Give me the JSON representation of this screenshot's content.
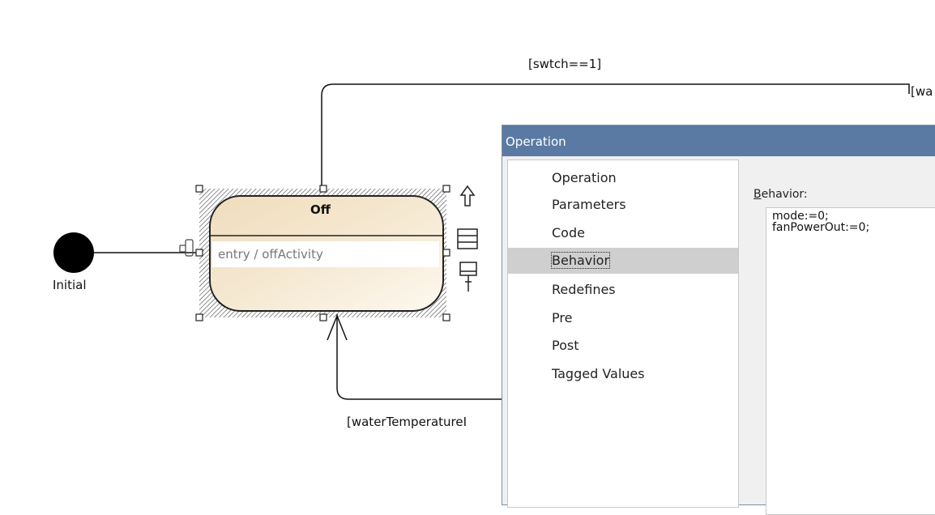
{
  "diagram": {
    "initial_label": "Initial",
    "state": {
      "name": "Off",
      "entry_action": "entry / offActivity"
    },
    "transition_top_label": "[swtch==1]",
    "transition_top_right_label": "[wa",
    "transition_bottom_label": "[waterTemperatureI"
  },
  "dialog": {
    "title": "Operation",
    "nav_items": [
      "Operation",
      "Parameters",
      "Code",
      "Behavior",
      "Redefines",
      "Pre",
      "Post",
      "Tagged Values"
    ],
    "selected_item": "Behavior",
    "behavior_label_mnemonic": "B",
    "behavior_label_rest": "ehavior:",
    "behavior_lines": [
      "mode:=0;",
      "fanPowerOut:=0;"
    ]
  }
}
